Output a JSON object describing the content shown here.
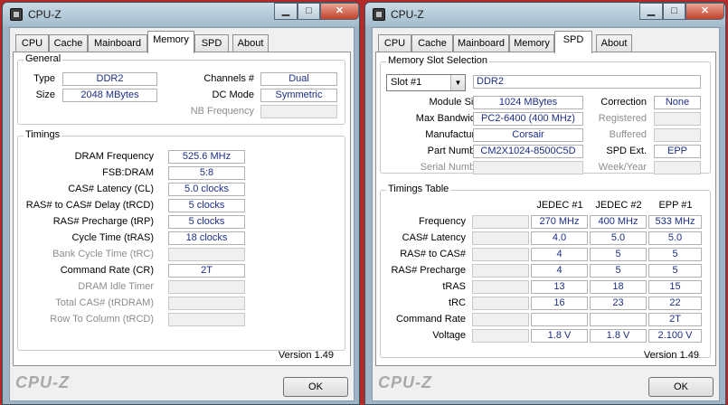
{
  "left_window": {
    "title": "CPU-Z",
    "tabs": [
      "CPU",
      "Cache",
      "Mainboard",
      "Memory",
      "SPD",
      "About"
    ],
    "active_tab": "Memory",
    "general": {
      "label": "General",
      "type_label": "Type",
      "type_value": "DDR2",
      "size_label": "Size",
      "size_value": "2048 MBytes",
      "channels_label": "Channels #",
      "channels_value": "Dual",
      "dcmode_label": "DC Mode",
      "dcmode_value": "Symmetric",
      "nbfreq_label": "NB Frequency",
      "nbfreq_value": ""
    },
    "timings": {
      "label": "Timings",
      "rows": [
        {
          "label": "DRAM Frequency",
          "value": "525.6 MHz",
          "enabled": true
        },
        {
          "label": "FSB:DRAM",
          "value": "5:8",
          "enabled": true
        },
        {
          "label": "CAS# Latency (CL)",
          "value": "5.0 clocks",
          "enabled": true
        },
        {
          "label": "RAS# to CAS# Delay (tRCD)",
          "value": "5 clocks",
          "enabled": true
        },
        {
          "label": "RAS# Precharge (tRP)",
          "value": "5 clocks",
          "enabled": true
        },
        {
          "label": "Cycle Time (tRAS)",
          "value": "18 clocks",
          "enabled": true
        },
        {
          "label": "Bank Cycle Time (tRC)",
          "value": "",
          "enabled": false
        },
        {
          "label": "Command Rate (CR)",
          "value": "2T",
          "enabled": true
        },
        {
          "label": "DRAM Idle Timer",
          "value": "",
          "enabled": false
        },
        {
          "label": "Total CAS# (tRDRAM)",
          "value": "",
          "enabled": false
        },
        {
          "label": "Row To Column (tRCD)",
          "value": "",
          "enabled": false
        }
      ]
    },
    "version": "Version 1.49",
    "brand": "CPU-Z",
    "ok_label": "OK"
  },
  "right_window": {
    "title": "CPU-Z",
    "tabs": [
      "CPU",
      "Cache",
      "Mainboard",
      "Memory",
      "SPD",
      "About"
    ],
    "active_tab": "SPD",
    "slot": {
      "label": "Memory Slot Selection",
      "selected": "Slot #1",
      "type_value": "DDR2",
      "module_size_label": "Module Size",
      "module_size_value": "1024 MBytes",
      "max_bandwidth_label": "Max Bandwidth",
      "max_bandwidth_value": "PC2-6400 (400 MHz)",
      "manufacturer_label": "Manufacturer",
      "manufacturer_value": "Corsair",
      "part_number_label": "Part Number",
      "part_number_value": "CM2X1024-8500C5D",
      "serial_label": "Serial Number",
      "serial_value": "",
      "correction_label": "Correction",
      "correction_value": "None",
      "registered_label": "Registered",
      "registered_value": "",
      "buffered_label": "Buffered",
      "buffered_value": "",
      "spd_ext_label": "SPD Ext.",
      "spd_ext_value": "EPP",
      "week_year_label": "Week/Year",
      "week_year_value": ""
    },
    "timings_table": {
      "label": "Timings Table",
      "columns": [
        "JEDEC #1",
        "JEDEC #2",
        "EPP #1"
      ],
      "rows": [
        {
          "label": "Frequency",
          "values": [
            "270 MHz",
            "400 MHz",
            "533 MHz"
          ]
        },
        {
          "label": "CAS# Latency",
          "values": [
            "4.0",
            "5.0",
            "5.0"
          ]
        },
        {
          "label": "RAS# to CAS#",
          "values": [
            "4",
            "5",
            "5"
          ]
        },
        {
          "label": "RAS# Precharge",
          "values": [
            "4",
            "5",
            "5"
          ]
        },
        {
          "label": "tRAS",
          "values": [
            "13",
            "18",
            "15"
          ]
        },
        {
          "label": "tRC",
          "values": [
            "16",
            "23",
            "22"
          ]
        },
        {
          "label": "Command Rate",
          "values": [
            "",
            "",
            "2T"
          ]
        },
        {
          "label": "Voltage",
          "values": [
            "1.8 V",
            "1.8 V",
            "2.100 V"
          ]
        }
      ]
    },
    "version": "Version 1.49",
    "brand": "CPU-Z",
    "ok_label": "OK"
  }
}
